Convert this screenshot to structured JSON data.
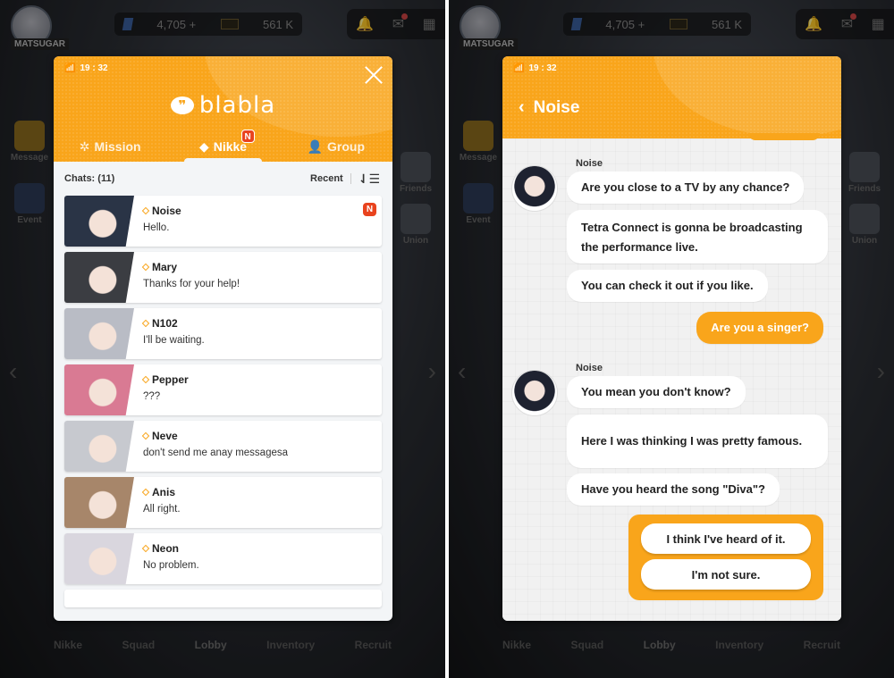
{
  "hud": {
    "player_name": "MATSUGAR",
    "gems": "4,705 +",
    "credits": "561 K"
  },
  "side_left": [
    "Message",
    "Event"
  ],
  "side_right": [
    "Friends",
    "Union"
  ],
  "bottom_nav": [
    "Nikke",
    "Squad",
    "Lobby",
    "Inventory",
    "Recruit"
  ],
  "bottom_nav_active": "Lobby",
  "left_panel": {
    "time": "19 : 32",
    "logo": "blabla",
    "logo_bubble": "❞",
    "tabs": [
      {
        "label": "Mission",
        "icon": "✲"
      },
      {
        "label": "Nikke",
        "icon": "◆",
        "badge": "N"
      },
      {
        "label": "Group",
        "icon": "👤"
      }
    ],
    "chats_count": "Chats: (11)",
    "sort_label": "Recent",
    "sort_icon": "⇃☰",
    "chats": [
      {
        "name": "Noise",
        "message": "Hello.",
        "badge": "N",
        "avatar_color": "#2a3446"
      },
      {
        "name": "Mary",
        "message": "Thanks for your help!",
        "avatar_color": "#3b3d42"
      },
      {
        "name": "N102",
        "message": "I'll be waiting.",
        "avatar_color": "#b9bcc5"
      },
      {
        "name": "Pepper",
        "message": "???",
        "avatar_color": "#d97a93"
      },
      {
        "name": "Neve",
        "message": "don't send me anay messagesa",
        "avatar_color": "#c7c9cf"
      },
      {
        "name": "Anis",
        "message": "All right.",
        "avatar_color": "#a7866a"
      },
      {
        "name": "Neon",
        "message": "No problem.",
        "avatar_color": "#d9d6de"
      }
    ]
  },
  "right_panel": {
    "time": "19 : 32",
    "back_icon": "‹",
    "title": "Noise",
    "messages": [
      {
        "sender": "Noise",
        "lines": [
          "Are you close to a TV by any chance?",
          "Tetra Connect is gonna be broadcasting the performance live.",
          "You can check it out if you like."
        ]
      },
      {
        "me": "Are you a singer?"
      },
      {
        "sender": "Noise",
        "lines": [
          "You mean you don't know?",
          "Here I was thinking I was pretty famous.",
          "Have you heard the song \"Diva\"?"
        ]
      }
    ],
    "choices": [
      "I think I've heard of it.",
      "I'm not sure."
    ]
  }
}
